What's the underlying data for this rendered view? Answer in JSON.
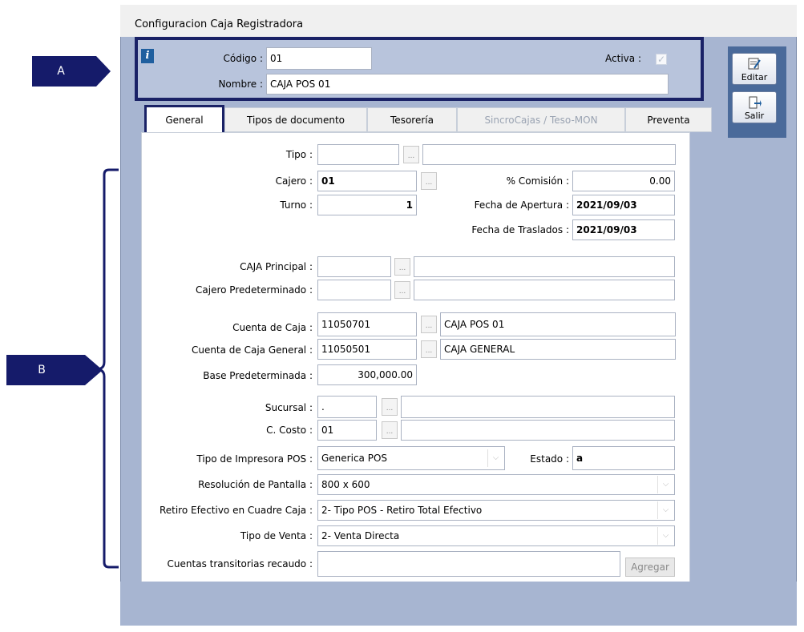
{
  "window": {
    "title": "Configuracion Caja Registradora"
  },
  "markers": {
    "a": "A",
    "b": "B"
  },
  "header": {
    "info_icon_glyph": "i",
    "codigo_label": "Código :",
    "codigo_value": "01",
    "nombre_label": "Nombre :",
    "nombre_value": "CAJA POS 01",
    "activa_label": "Activa :",
    "activa_checked": true
  },
  "toolbar": {
    "editar": "Editar",
    "salir": "Salir"
  },
  "tabs": [
    {
      "label": "General",
      "active": true
    },
    {
      "label": "Tipos de documento"
    },
    {
      "label": "Tesorería"
    },
    {
      "label": "SincroCajas / Teso-MON",
      "disabled": true
    },
    {
      "label": "Preventa"
    }
  ],
  "form": {
    "tipo": {
      "label": "Tipo :",
      "code": "",
      "desc": ""
    },
    "cajero": {
      "label": "Cajero :",
      "value": "01"
    },
    "comision": {
      "label": "% Comisión :",
      "value": "0.00"
    },
    "turno": {
      "label": "Turno :",
      "value": "1"
    },
    "fecha_apertura": {
      "label": "Fecha de Apertura :",
      "value": "2021/09/03"
    },
    "fecha_traslados": {
      "label": "Fecha de Traslados :",
      "value": "2021/09/03"
    },
    "caja_principal": {
      "label": "CAJA Principal :",
      "code": "",
      "desc": ""
    },
    "cajero_predeterminado": {
      "label": "Cajero Predeterminado :",
      "code": "",
      "desc": ""
    },
    "cuenta_caja": {
      "label": "Cuenta de Caja :",
      "code": "11050701",
      "desc": "CAJA POS 01"
    },
    "cuenta_caja_general": {
      "label": "Cuenta de Caja General :",
      "code": "11050501",
      "desc": "CAJA GENERAL"
    },
    "base_predeterminada": {
      "label": "Base Predeterminada :",
      "value": "300,000.00"
    },
    "sucursal": {
      "label": "Sucursal :",
      "code": ".",
      "desc": ""
    },
    "c_costo": {
      "label": "C. Costo :",
      "code": "01",
      "desc": ""
    },
    "tipo_impresora": {
      "label": "Tipo de Impresora POS :",
      "value": "Generica POS"
    },
    "estado": {
      "label": "Estado :",
      "value": "a"
    },
    "resolucion": {
      "label": "Resolución de Pantalla :",
      "value": "800 x 600"
    },
    "retiro": {
      "label": "Retiro Efectivo en Cuadre Caja :",
      "value": "2- Tipo POS - Retiro Total Efectivo"
    },
    "tipo_venta": {
      "label": "Tipo de Venta :",
      "value": "2- Venta Directa"
    },
    "cuentas_transitorias": {
      "label": "Cuentas transitorias recaudo :",
      "value": ""
    },
    "agregar": "Agregar",
    "dots": "...",
    "combo_arrow": "⌵"
  },
  "colors": {
    "frame_blue": "#1a2266",
    "marker_blue": "#151b6a",
    "window_bg": "#a7b5d1",
    "toolbar_bg": "#4a6a9a"
  }
}
